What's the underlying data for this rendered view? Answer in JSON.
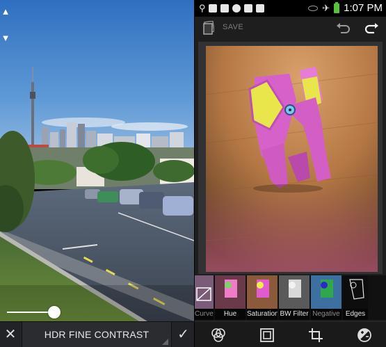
{
  "left_screen": {
    "arrows": [
      "▲",
      "▼"
    ],
    "slider": {
      "value": 0.76
    },
    "toolbar": {
      "close_glyph": "✕",
      "filter_name": "HDR FINE CONTRAST",
      "confirm_glyph": "✓"
    },
    "icons": [
      "arrow-up-icon",
      "arrow-down-icon",
      "close-icon",
      "dropdown-corner-icon",
      "check-icon"
    ]
  },
  "right_screen": {
    "status_bar": {
      "time": "1:07 PM",
      "left_icons": [
        "usb-icon",
        "image-icon",
        "gmail-icon",
        "cloud-upload-icon",
        "check-box-icon",
        "play-store-icon"
      ],
      "right_icons": [
        "eye-icon",
        "airplane-icon",
        "battery-icon"
      ]
    },
    "top_bar": {
      "save_label": "SAVE",
      "icons": [
        "app-logo-icon",
        "undo-icon",
        "redo-icon"
      ]
    },
    "filters": [
      {
        "label": "Curves",
        "selected": true
      },
      {
        "label": "Hue",
        "selected": false
      },
      {
        "label": "Saturation",
        "selected": false
      },
      {
        "label": "BW Filter",
        "selected": false
      },
      {
        "label": "Negative",
        "selected": true
      },
      {
        "label": "Edges",
        "selected": false
      }
    ],
    "bottom_nav": {
      "icons": [
        "effects-icon",
        "frame-icon",
        "crop-icon",
        "adjust-icon"
      ]
    }
  },
  "colors": {
    "dark_bar": "#222326",
    "title_bg": "#2b2c30",
    "battery_green": "#56c43a",
    "elephant_pink": "#d060c8",
    "elephant_ear_yellow": "#e6e44a"
  }
}
